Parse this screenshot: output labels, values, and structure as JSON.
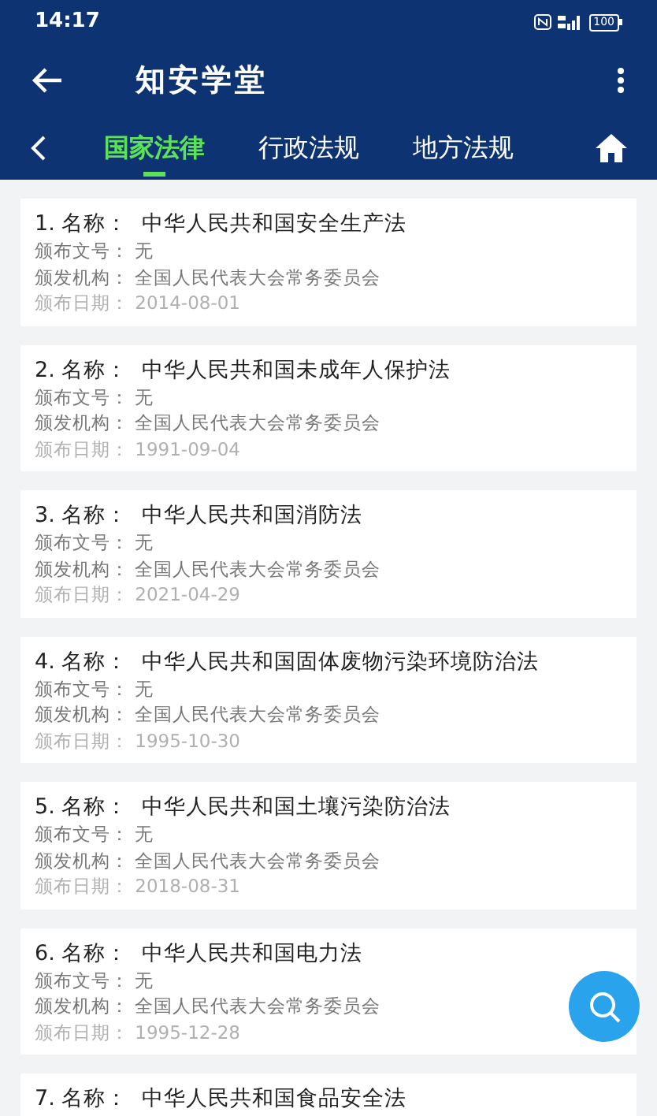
{
  "status_bar": {
    "time": "14:17",
    "battery": "100"
  },
  "app_bar": {
    "title": "知安学堂"
  },
  "tabs": [
    {
      "label": "国家法律",
      "selected": true
    },
    {
      "label": "行政法规",
      "selected": false
    },
    {
      "label": "地方法规",
      "selected": false
    }
  ],
  "laws": [
    {
      "title": "1. 名称：  中华人民共和国安全生产法",
      "fields": [
        {
          "label": "颁布文号：",
          "value": "无",
          "kind": "normal"
        },
        {
          "label": "颁发机构：",
          "value": "全国人民代表大会常务委员会",
          "kind": "normal"
        },
        {
          "label": "颁布日期：",
          "value": "2014-08-01",
          "kind": "date"
        }
      ]
    },
    {
      "title": "2. 名称：  中华人民共和国未成年人保护法",
      "fields": [
        {
          "label": "颁布文号：",
          "value": "无",
          "kind": "normal"
        },
        {
          "label": "颁发机构：",
          "value": "全国人民代表大会常务委员会",
          "kind": "normal"
        },
        {
          "label": "颁布日期：",
          "value": "1991-09-04",
          "kind": "date"
        }
      ]
    },
    {
      "title": "3. 名称：  中华人民共和国消防法",
      "fields": [
        {
          "label": "颁布文号：",
          "value": "无",
          "kind": "normal"
        },
        {
          "label": "颁发机构：",
          "value": "全国人民代表大会常务委员会",
          "kind": "normal"
        },
        {
          "label": "颁布日期：",
          "value": "2021-04-29",
          "kind": "date"
        }
      ]
    },
    {
      "title": "4. 名称：  中华人民共和国固体废物污染环境防治法",
      "fields": [
        {
          "label": "颁布文号：",
          "value": "无",
          "kind": "normal"
        },
        {
          "label": "颁发机构：",
          "value": "全国人民代表大会常务委员会",
          "kind": "normal"
        },
        {
          "label": "颁布日期：",
          "value": "1995-10-30",
          "kind": "date"
        }
      ]
    },
    {
      "title": "5. 名称：  中华人民共和国土壤污染防治法",
      "fields": [
        {
          "label": "颁布文号：",
          "value": "无",
          "kind": "normal"
        },
        {
          "label": "颁发机构：",
          "value": "全国人民代表大会常务委员会",
          "kind": "normal"
        },
        {
          "label": "颁布日期：",
          "value": "2018-08-31",
          "kind": "date"
        }
      ]
    },
    {
      "title": "6. 名称：  中华人民共和国电力法",
      "fields": [
        {
          "label": "颁布文号：",
          "value": "无",
          "kind": "normal"
        },
        {
          "label": "颁发机构：",
          "value": "全国人民代表大会常务委员会",
          "kind": "normal"
        },
        {
          "label": "颁布日期：",
          "value": "1995-12-28",
          "kind": "date"
        }
      ]
    },
    {
      "title": "7. 名称：  中华人民共和国食品安全法"
    }
  ]
}
